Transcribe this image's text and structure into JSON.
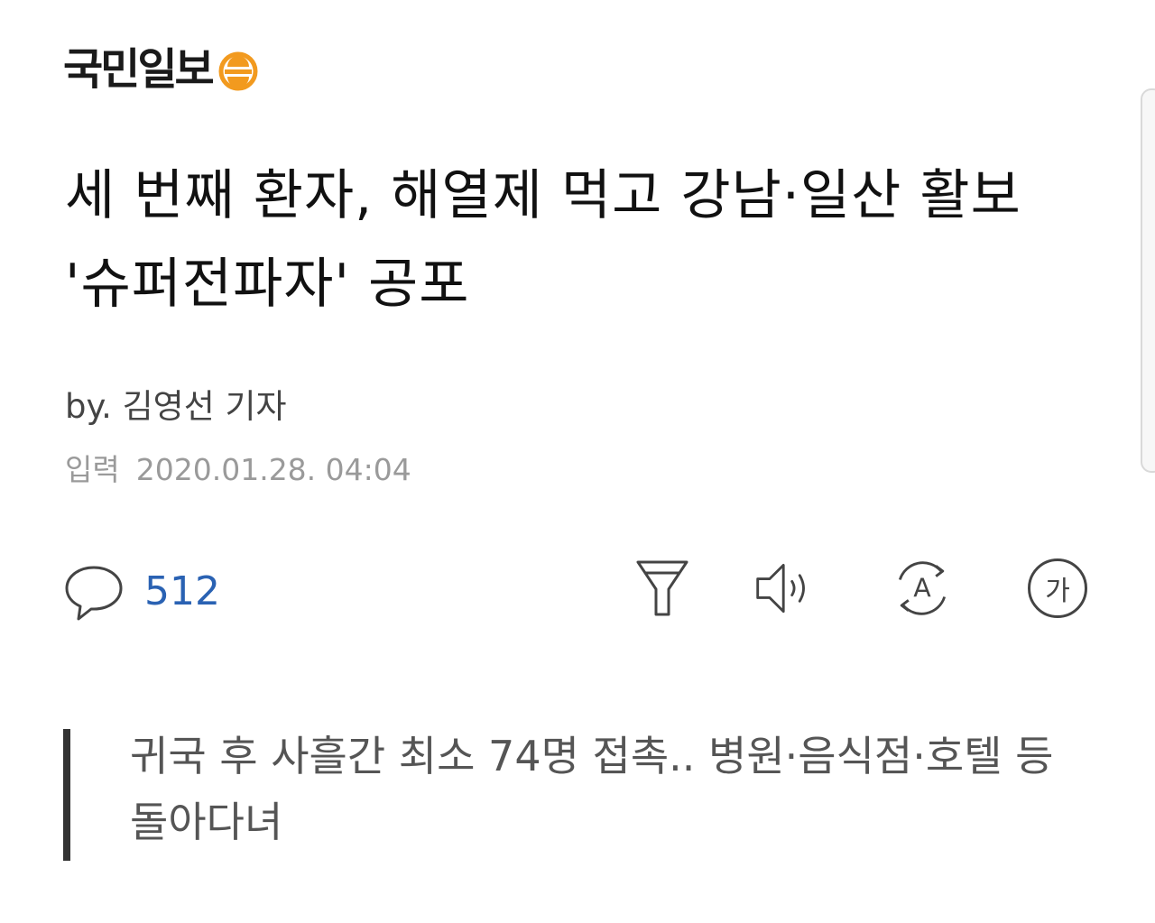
{
  "brand": {
    "name": "국민일보",
    "accent": "#f29a1f"
  },
  "article": {
    "title": "세 번째 환자, 해열제 먹고 강남·일산 활보 '슈퍼전파자' 공포",
    "byline": "by. 김영선 기자",
    "date_label": "입력",
    "date_value": "2020.01.28. 04:04",
    "subtitle": "귀국 후 사흘간 최소 74명 접촉.. 병원·음식점·호텔 등 돌아다녀"
  },
  "toolbar": {
    "comment_icon": "speech-bubble-icon",
    "comment_count": "512",
    "comment_color": "#2a62b3",
    "icons": [
      "filter-funnel-icon",
      "speaker-icon",
      "translate-icon",
      "font-size-icon"
    ],
    "fontsize_glyph": "가",
    "translate_glyph": "A"
  }
}
